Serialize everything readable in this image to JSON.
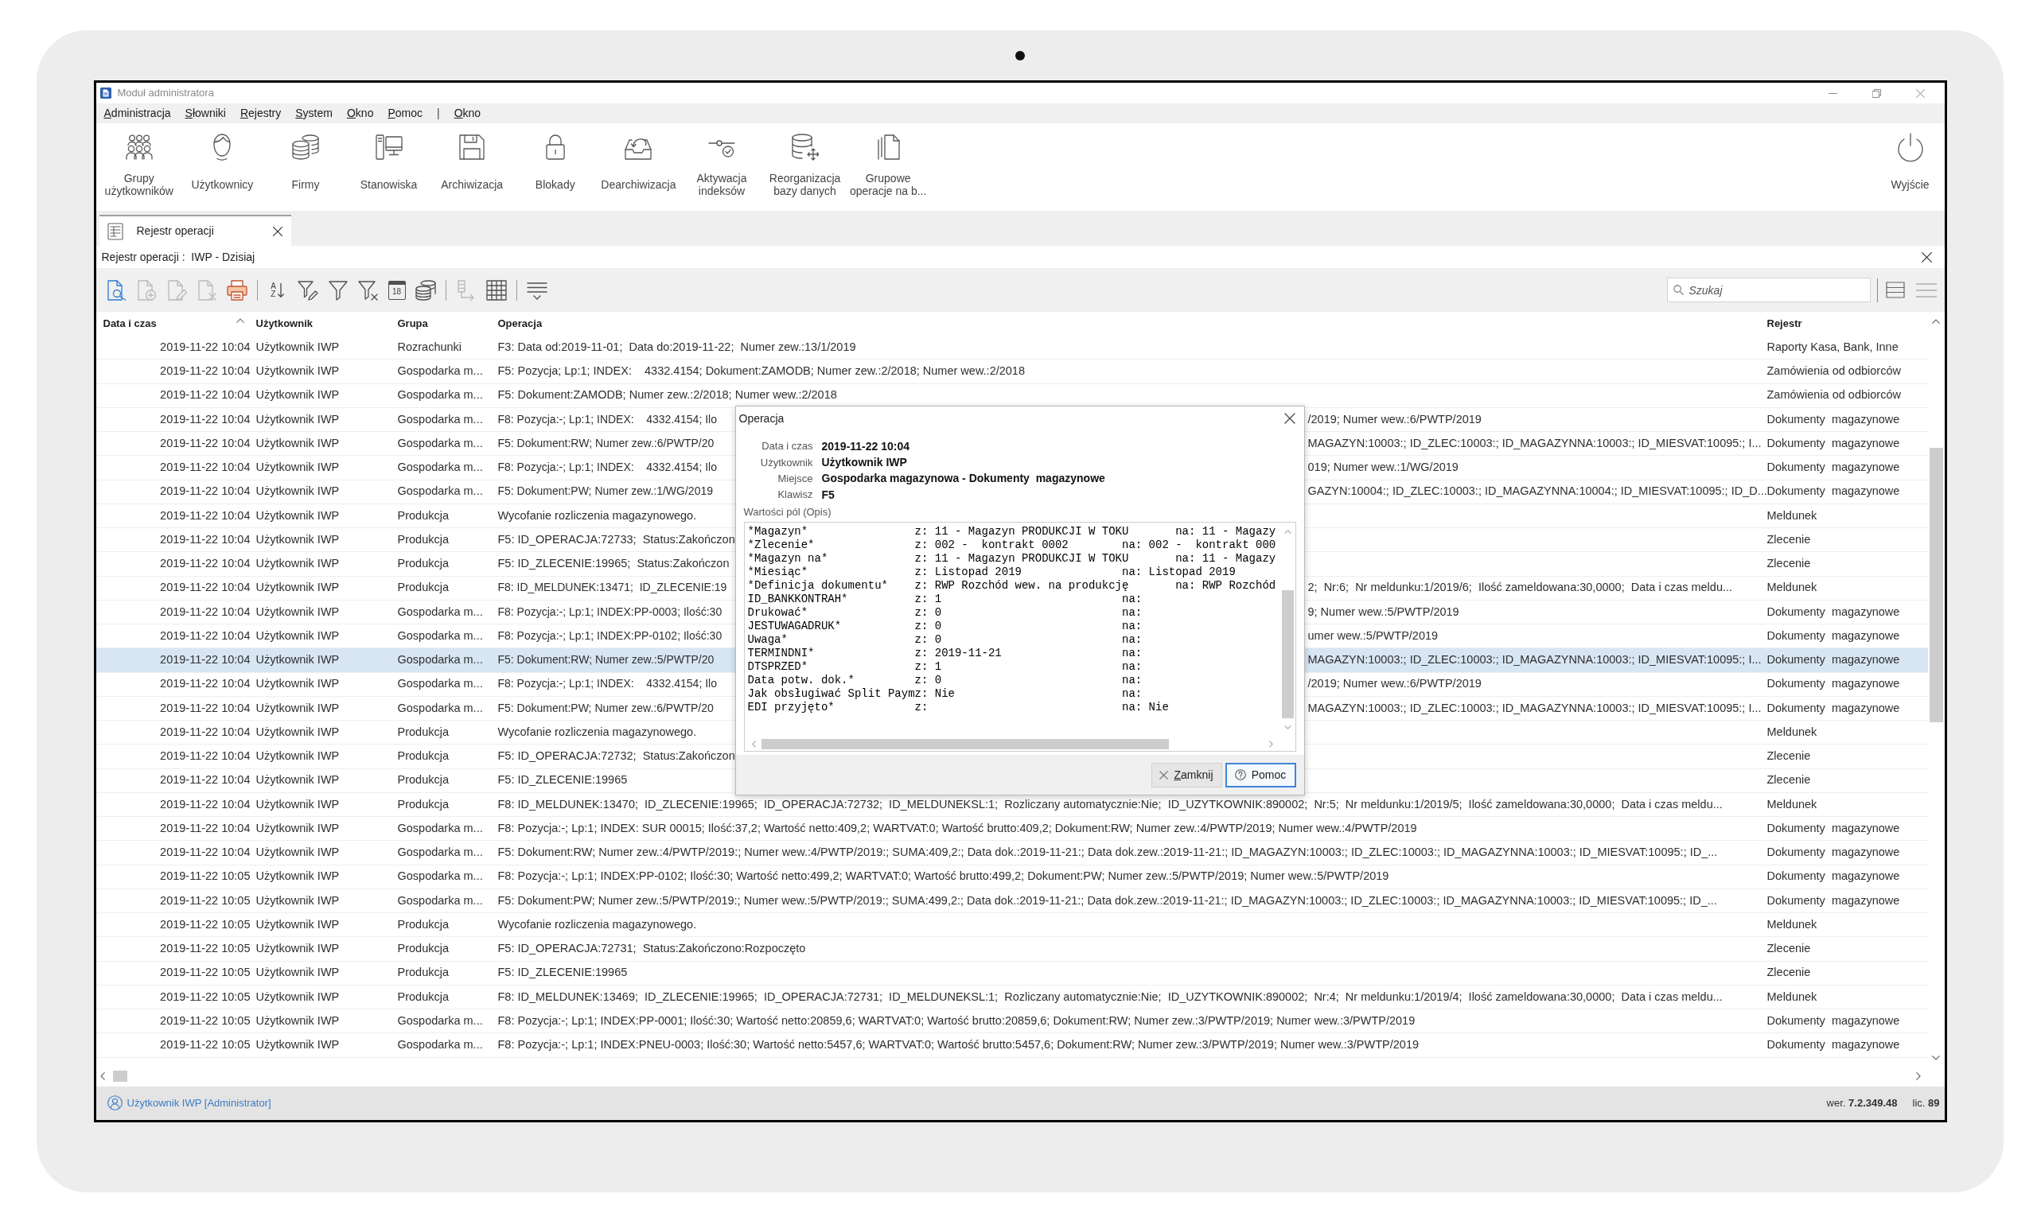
{
  "window": {
    "title": "Moduł administratora"
  },
  "menu": [
    {
      "label": "Administracja",
      "kind": "item"
    },
    {
      "label": "Słowniki",
      "kind": "item"
    },
    {
      "label": "Rejestry",
      "kind": "item"
    },
    {
      "label": "System",
      "kind": "item"
    },
    {
      "label": "Okno",
      "kind": "item"
    },
    {
      "label": "Pomoc",
      "kind": "item"
    },
    {
      "label": "|",
      "kind": "separator"
    },
    {
      "label": "Okno",
      "kind": "item"
    }
  ],
  "ribbon": {
    "buttons": [
      {
        "kind": "user_groups",
        "lines": [
          "Grupy",
          "użytkowników"
        ]
      },
      {
        "kind": "users",
        "lines": [
          "Użytkownicy"
        ]
      },
      {
        "kind": "companies",
        "lines": [
          "Firmy"
        ]
      },
      {
        "kind": "workstations",
        "lines": [
          "Stanowiska"
        ]
      },
      {
        "kind": "archiving",
        "lines": [
          "Archiwizacja"
        ]
      },
      {
        "kind": "locks",
        "lines": [
          "Blokady"
        ]
      },
      {
        "kind": "dearchiving",
        "lines": [
          "Dearchiwizacja"
        ]
      },
      {
        "kind": "index_activation",
        "lines": [
          "Aktywacja",
          "indeksów"
        ]
      },
      {
        "kind": "db_reorganization",
        "lines": [
          "Reorganizacja",
          "bazy danych"
        ]
      },
      {
        "kind": "group_operations",
        "lines": [
          "Grupowe",
          "operacje na b..."
        ]
      }
    ],
    "exit": {
      "kind": "exit",
      "lines": [
        "Wyjście"
      ]
    }
  },
  "tabs": [
    {
      "label": "Rejestr operacji",
      "selected": true
    }
  ],
  "breadcrumb": "Rejestr operacji :  IWP - Dzisiaj",
  "toolbar": {
    "buttons": [
      {
        "kind": "preview",
        "disabled": false
      },
      {
        "kind": "add",
        "disabled": true
      },
      {
        "kind": "edit",
        "disabled": true
      },
      {
        "kind": "delete",
        "disabled": true
      },
      {
        "kind": "print",
        "disabled": false
      },
      {
        "kind": "separator"
      },
      {
        "kind": "sort",
        "disabled": false,
        "letters": [
          "A",
          "Z"
        ]
      },
      {
        "kind": "filter_edit",
        "disabled": false
      },
      {
        "kind": "filter",
        "disabled": false
      },
      {
        "kind": "filter_clear",
        "disabled": false
      },
      {
        "kind": "calendar",
        "disabled": false,
        "text": "18"
      },
      {
        "kind": "database",
        "disabled": false
      },
      {
        "kind": "separator"
      },
      {
        "kind": "link_grid",
        "disabled": true
      },
      {
        "kind": "grid",
        "disabled": false
      },
      {
        "kind": "separator"
      },
      {
        "kind": "rows",
        "disabled": false
      }
    ],
    "search": {
      "placeholder": "Szukaj"
    }
  },
  "table": {
    "columns": [
      {
        "label": "Data i czas",
        "sorted": true
      },
      {
        "label": "Użytkownik",
        "sorted": false
      },
      {
        "label": "Grupa",
        "sorted": false
      },
      {
        "label": "Operacja",
        "sorted": false
      },
      {
        "label": "Rejestr",
        "sorted": false
      }
    ],
    "rows": [
      {
        "datetime": "2019-11-22 10:04",
        "user": "Użytkownik IWP",
        "group": "Rozrachunki",
        "operation": "F3: Data od:2019-11-01;  Data do:2019-11-22;  Numer zew.:13/1/2019",
        "register": "Raporty Kasa, Bank, Inne",
        "selected": false
      },
      {
        "datetime": "2019-11-22 10:04",
        "user": "Użytkownik IWP",
        "group": "Gospodarka m...",
        "operation": "F5: Pozycja; Lp:1; INDEX:    4332.4154; Dokument:ZAMODB; Numer zew.:2/2018; Numer wew.:2/2018",
        "register": "Zamówienia od odbiorców",
        "selected": false
      },
      {
        "datetime": "2019-11-22 10:04",
        "user": "Użytkownik IWP",
        "group": "Gospodarka m...",
        "operation": "F5: Dokument:ZAMODB; Numer zew.:2/2018; Numer wew.:2/2018",
        "register": "Zamówienia od odbiorców",
        "selected": false
      },
      {
        "datetime": "2019-11-22 10:04",
        "user": "Użytkownik IWP",
        "group": "Gospodarka m...",
        "operation": "F8: Pozycja:-; Lp:1; INDEX:    4332.4154; Ilo",
        "operation_end": "/2019; Numer wew.:6/PWTP/2019",
        "register": "Dokumenty  magazynowe",
        "selected": false
      },
      {
        "datetime": "2019-11-22 10:04",
        "user": "Użytkownik IWP",
        "group": "Gospodarka m...",
        "operation": "F5: Dokument:RW; Numer zew.:6/PWTP/20",
        "operation_end": "MAGAZYN:10003:; ID_ZLEC:10003:; ID_MAGAZYNNA:10003:; ID_MIESVAT:10095:; I...",
        "register": "Dokumenty  magazynowe",
        "selected": false
      },
      {
        "datetime": "2019-11-22 10:04",
        "user": "Użytkownik IWP",
        "group": "Gospodarka m...",
        "operation": "F8: Pozycja:-; Lp:1; INDEX:    4332.4154; Ilo",
        "operation_end": "019; Numer wew.:1/WG/2019",
        "register": "Dokumenty  magazynowe",
        "selected": false
      },
      {
        "datetime": "2019-11-22 10:04",
        "user": "Użytkownik IWP",
        "group": "Gospodarka m...",
        "operation": "F5: Dokument:PW; Numer zew.:1/WG/2019",
        "operation_end": "GAZYN:10004:; ID_ZLEC:10003:; ID_MAGAZYNNA:10004:; ID_MIESVAT:10095:; ID_D...",
        "register": "Dokumenty  magazynowe",
        "selected": false
      },
      {
        "datetime": "2019-11-22 10:04",
        "user": "Użytkownik IWP",
        "group": "Produkcja",
        "operation": "Wycofanie rozliczenia magazynowego.",
        "register": "Meldunek",
        "selected": false
      },
      {
        "datetime": "2019-11-22 10:04",
        "user": "Użytkownik IWP",
        "group": "Produkcja",
        "operation": "F5: ID_OPERACJA:72733;  Status:Zakończon",
        "register": "Zlecenie",
        "selected": false
      },
      {
        "datetime": "2019-11-22 10:04",
        "user": "Użytkownik IWP",
        "group": "Produkcja",
        "operation": "F5: ID_ZLECENIE:19965;  Status:Zakończon",
        "register": "Zlecenie",
        "selected": false
      },
      {
        "datetime": "2019-11-22 10:04",
        "user": "Użytkownik IWP",
        "group": "Produkcja",
        "operation": "F8: ID_MELDUNEK:13471;  ID_ZLECENIE:19",
        "operation_end": "2;  Nr:6;  Nr meldunku:1/2019/6;  Ilość zameldowana:30,0000;  Data i czas meldu...",
        "register": "Meldunek",
        "selected": false
      },
      {
        "datetime": "2019-11-22 10:04",
        "user": "Użytkownik IWP",
        "group": "Gospodarka m...",
        "operation": "F8: Pozycja:-; Lp:1; INDEX:PP-0003; Ilość:30",
        "operation_end": "9; Numer wew.:5/PWTP/2019",
        "register": "Dokumenty  magazynowe",
        "selected": false
      },
      {
        "datetime": "2019-11-22 10:04",
        "user": "Użytkownik IWP",
        "group": "Gospodarka m...",
        "operation": "F8: Pozycja:-; Lp:1; INDEX:PP-0102; Ilość:30",
        "operation_end": "umer wew.:5/PWTP/2019",
        "register": "Dokumenty  magazynowe",
        "selected": false
      },
      {
        "datetime": "2019-11-22 10:04",
        "user": "Użytkownik IWP",
        "group": "Gospodarka m...",
        "operation": "F5: Dokument:RW; Numer zew.:5/PWTP/20",
        "operation_end": "MAGAZYN:10003:; ID_ZLEC:10003:; ID_MAGAZYNNA:10003:; ID_MIESVAT:10095:; I...",
        "register": "Dokumenty  magazynowe",
        "selected": true
      },
      {
        "datetime": "2019-11-22 10:04",
        "user": "Użytkownik IWP",
        "group": "Gospodarka m...",
        "operation": "F8: Pozycja:-; Lp:1; INDEX:    4332.4154; Ilo",
        "operation_end": "/2019; Numer wew.:6/PWTP/2019",
        "register": "Dokumenty  magazynowe",
        "selected": false
      },
      {
        "datetime": "2019-11-22 10:04",
        "user": "Użytkownik IWP",
        "group": "Gospodarka m...",
        "operation": "F5: Dokument:PW; Numer zew.:6/PWTP/20",
        "operation_end": "MAGAZYN:10003:; ID_ZLEC:10003:; ID_MAGAZYNNA:10003:; ID_MIESVAT:10095:; I...",
        "register": "Dokumenty  magazynowe",
        "selected": false
      },
      {
        "datetime": "2019-11-22 10:04",
        "user": "Użytkownik IWP",
        "group": "Produkcja",
        "operation": "Wycofanie rozliczenia magazynowego.",
        "register": "Meldunek",
        "selected": false
      },
      {
        "datetime": "2019-11-22 10:04",
        "user": "Użytkownik IWP",
        "group": "Produkcja",
        "operation": "F5: ID_OPERACJA:72732;  Status:Zakończon",
        "register": "Zlecenie",
        "selected": false
      },
      {
        "datetime": "2019-11-22 10:04",
        "user": "Użytkownik IWP",
        "group": "Produkcja",
        "operation": "F5: ID_ZLECENIE:19965",
        "register": "Zlecenie",
        "selected": false
      },
      {
        "datetime": "2019-11-22 10:04",
        "user": "Użytkownik IWP",
        "group": "Produkcja",
        "operation": "F8: ID_MELDUNEK:13470;  ID_ZLECENIE:19965;  ID_OPERACJA:72732;  ID_MELDUNEKSL:1;  Rozliczany automatycznie:Nie;  ID_UZYTKOWNIK:890002;  Nr:5;  Nr meldunku:1/2019/5;  Ilość zameldowana:30,0000;  Data i czas meldu...",
        "register": "Meldunek",
        "selected": false
      },
      {
        "datetime": "2019-11-22 10:04",
        "user": "Użytkownik IWP",
        "group": "Gospodarka m...",
        "operation": "F8: Pozycja:-; Lp:1; INDEX: SUR 00015; Ilość:37,2; Wartość netto:409,2; WARTVAT:0; Wartość brutto:409,2; Dokument:RW; Numer zew.:4/PWTP/2019; Numer wew.:4/PWTP/2019",
        "register": "Dokumenty  magazynowe",
        "selected": false
      },
      {
        "datetime": "2019-11-22 10:04",
        "user": "Użytkownik IWP",
        "group": "Gospodarka m...",
        "operation": "F5: Dokument:RW; Numer zew.:4/PWTP/2019:; Numer wew.:4/PWTP/2019:; SUMA:409,2:; Data dok.:2019-11-21:; Data dok.zew.:2019-11-21:; ID_MAGAZYN:10003:; ID_ZLEC:10003:; ID_MAGAZYNNA:10003:; ID_MIESVAT:10095:; ID_...",
        "register": "Dokumenty  magazynowe",
        "selected": false
      },
      {
        "datetime": "2019-11-22 10:05",
        "user": "Użytkownik IWP",
        "group": "Gospodarka m...",
        "operation": "F8: Pozycja:-; Lp:1; INDEX:PP-0102; Ilość:30; Wartość netto:499,2; WARTVAT:0; Wartość brutto:499,2; Dokument:PW; Numer zew.:5/PWTP/2019; Numer wew.:5/PWTP/2019",
        "register": "Dokumenty  magazynowe",
        "selected": false
      },
      {
        "datetime": "2019-11-22 10:05",
        "user": "Użytkownik IWP",
        "group": "Gospodarka m...",
        "operation": "F5: Dokument:PW; Numer zew.:5/PWTP/2019:; Numer wew.:5/PWTP/2019:; SUMA:499,2:; Data dok.:2019-11-21:; Data dok.zew.:2019-11-21:; ID_MAGAZYN:10003:; ID_ZLEC:10003:; ID_MAGAZYNNA:10003:; ID_MIESVAT:10095:; ID_...",
        "register": "Dokumenty  magazynowe",
        "selected": false
      },
      {
        "datetime": "2019-11-22 10:05",
        "user": "Użytkownik IWP",
        "group": "Produkcja",
        "operation": "Wycofanie rozliczenia magazynowego.",
        "register": "Meldunek",
        "selected": false
      },
      {
        "datetime": "2019-11-22 10:05",
        "user": "Użytkownik IWP",
        "group": "Produkcja",
        "operation": "F5: ID_OPERACJA:72731;  Status:Zakończono:Rozpoczęto",
        "register": "Zlecenie",
        "selected": false
      },
      {
        "datetime": "2019-11-22 10:05",
        "user": "Użytkownik IWP",
        "group": "Produkcja",
        "operation": "F5: ID_ZLECENIE:19965",
        "register": "Zlecenie",
        "selected": false
      },
      {
        "datetime": "2019-11-22 10:05",
        "user": "Użytkownik IWP",
        "group": "Produkcja",
        "operation": "F8: ID_MELDUNEK:13469;  ID_ZLECENIE:19965;  ID_OPERACJA:72731;  ID_MELDUNEKSL:1;  Rozliczany automatycznie:Nie;  ID_UZYTKOWNIK:890002;  Nr:4;  Nr meldunku:1/2019/4;  Ilość zameldowana:30,0000;  Data i czas meldu...",
        "register": "Meldunek",
        "selected": false
      },
      {
        "datetime": "2019-11-22 10:05",
        "user": "Użytkownik IWP",
        "group": "Gospodarka m...",
        "operation": "F8: Pozycja:-; Lp:1; INDEX:PP-0001; Ilość:30; Wartość netto:20859,6; WARTVAT:0; Wartość brutto:20859,6; Dokument:RW; Numer zew.:3/PWTP/2019; Numer wew.:3/PWTP/2019",
        "register": "Dokumenty  magazynowe",
        "selected": false
      },
      {
        "datetime": "2019-11-22 10:05",
        "user": "Użytkownik IWP",
        "group": "Gospodarka m...",
        "operation": "F8: Pozycja:-; Lp:1; INDEX:PNEU-0003; Ilość:30; Wartość netto:5457,6; WARTVAT:0; Wartość brutto:5457,6; Dokument:RW; Numer zew.:3/PWTP/2019; Numer wew.:3/PWTP/2019",
        "register": "Dokumenty  magazynowe",
        "selected": false
      }
    ]
  },
  "dialog": {
    "title": "Operacja",
    "fields": [
      {
        "label": "Data i czas",
        "value": "2019-11-22 10:04"
      },
      {
        "label": "Użytkownik",
        "value": "Użytkownik IWP"
      },
      {
        "label": "Miejsce",
        "value": "Gospodarka magazynowa - Dokumenty  magazynowe"
      },
      {
        "label": "Klawisz",
        "value": "F5"
      }
    ],
    "description_label": "Wartości pól (Opis)",
    "description_lines": [
      "*Magazyn*                z: 11 - Magazyn PRODUKCJI W TOKU       na: 11 - Magazy",
      "*Zlecenie*               z: 002 -  kontrakt 0002        na: 002 -  kontrakt 000",
      "*Magazyn na*             z: 11 - Magazyn PRODUKCJI W TOKU       na: 11 - Magazy",
      "*Miesiąc*                z: Listopad 2019               na: Listopad 2019",
      "*Definicja dokumentu*    z: RWP Rozchód wew. na produkcję       na: RWP Rozchód",
      "ID_BANKKONTRAH*          z: 1                           na:",
      "Drukować*                z: 0                           na:",
      "JESTUWAGADRUK*           z: 0                           na:",
      "Uwaga*                   z: 0                           na:",
      "TERMINDNI*               z: 2019-11-21                  na:",
      "DTSPRZED*                z: 1                           na:",
      "Data potw. dok.*         z: 0                           na:",
      "Jak obsługiwać Split Paymz: Nie                         na:",
      "EDI przyjęto*            z:                             na: Nie"
    ],
    "buttons": [
      {
        "kind": "close",
        "label": "Zamknij",
        "focused": false
      },
      {
        "kind": "help",
        "label": "Pomoc",
        "focused": true
      }
    ]
  },
  "status_bar": {
    "user": "Użytkownik IWP [Administrator]",
    "version": "wer. **7.2.349.48**",
    "license": "lic. **89**"
  }
}
